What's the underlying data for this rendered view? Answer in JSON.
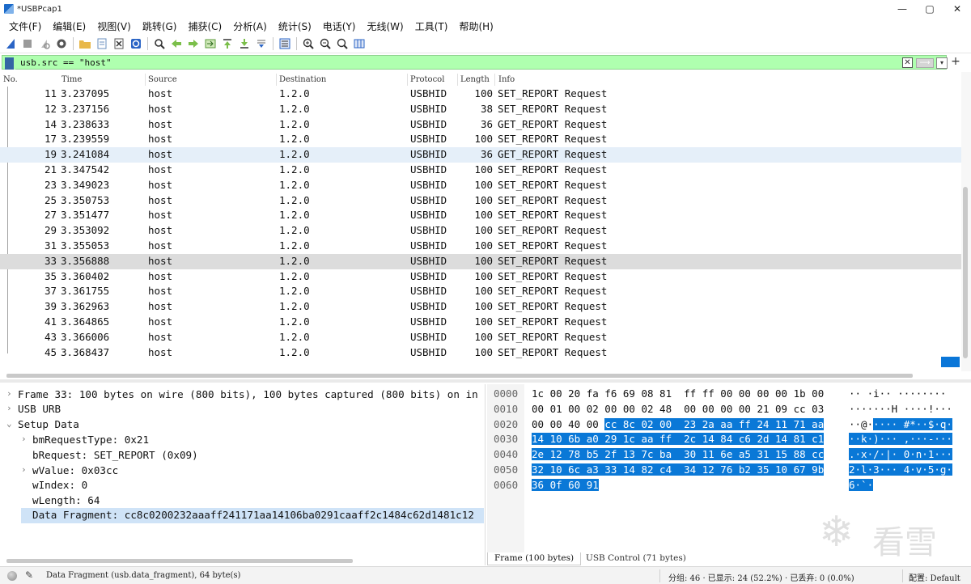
{
  "window": {
    "title": "*USBPcap1",
    "controls": [
      "—",
      "▢",
      "✕"
    ]
  },
  "menu": [
    "文件(F)",
    "编辑(E)",
    "视图(V)",
    "跳转(G)",
    "捕获(C)",
    "分析(A)",
    "统计(S)",
    "电话(Y)",
    "无线(W)",
    "工具(T)",
    "帮助(H)"
  ],
  "toolbar": {
    "icons": [
      "shark-fin-start-icon",
      "stop-icon",
      "restart-icon",
      "capture-options-icon",
      "open-folder-icon",
      "save-file-icon",
      "close-file-icon",
      "reload-icon",
      "find-packet-icon",
      "go-back-icon",
      "go-forward-icon",
      "go-to-packet-icon",
      "first-packet-icon",
      "last-packet-icon",
      "autoscroll-icon",
      "colorize-icon",
      "zoom-in-icon",
      "zoom-out-icon",
      "zoom-normal-icon",
      "resize-columns-icon"
    ]
  },
  "filter": {
    "value": "usb.src == \"host\"",
    "clear_symbol": "✕",
    "apply_symbol": "⟶",
    "dropdown_symbol": "▾",
    "add_symbol": "+"
  },
  "packet_list": {
    "columns": [
      "No.",
      "Time",
      "Source",
      "Destination",
      "Protocol",
      "Length",
      "Info"
    ],
    "rows": [
      {
        "no": "11",
        "time": "3.237095",
        "source": "host",
        "destination": "1.2.0",
        "protocol": "USBHID",
        "length": "100",
        "info": "SET_REPORT Request"
      },
      {
        "no": "12",
        "time": "3.237156",
        "source": "host",
        "destination": "1.2.0",
        "protocol": "USBHID",
        "length": "38",
        "info": "SET_REPORT Request"
      },
      {
        "no": "14",
        "time": "3.238633",
        "source": "host",
        "destination": "1.2.0",
        "protocol": "USBHID",
        "length": "36",
        "info": "GET_REPORT Request"
      },
      {
        "no": "17",
        "time": "3.239559",
        "source": "host",
        "destination": "1.2.0",
        "protocol": "USBHID",
        "length": "100",
        "info": "SET_REPORT Request"
      },
      {
        "no": "19",
        "time": "3.241084",
        "source": "host",
        "destination": "1.2.0",
        "protocol": "USBHID",
        "length": "36",
        "info": "GET_REPORT Request"
      },
      {
        "no": "21",
        "time": "3.347542",
        "source": "host",
        "destination": "1.2.0",
        "protocol": "USBHID",
        "length": "100",
        "info": "SET_REPORT Request"
      },
      {
        "no": "23",
        "time": "3.349023",
        "source": "host",
        "destination": "1.2.0",
        "protocol": "USBHID",
        "length": "100",
        "info": "SET_REPORT Request"
      },
      {
        "no": "25",
        "time": "3.350753",
        "source": "host",
        "destination": "1.2.0",
        "protocol": "USBHID",
        "length": "100",
        "info": "SET_REPORT Request"
      },
      {
        "no": "27",
        "time": "3.351477",
        "source": "host",
        "destination": "1.2.0",
        "protocol": "USBHID",
        "length": "100",
        "info": "SET_REPORT Request"
      },
      {
        "no": "29",
        "time": "3.353092",
        "source": "host",
        "destination": "1.2.0",
        "protocol": "USBHID",
        "length": "100",
        "info": "SET_REPORT Request"
      },
      {
        "no": "31",
        "time": "3.355053",
        "source": "host",
        "destination": "1.2.0",
        "protocol": "USBHID",
        "length": "100",
        "info": "SET_REPORT Request"
      },
      {
        "no": "33",
        "time": "3.356888",
        "source": "host",
        "destination": "1.2.0",
        "protocol": "USBHID",
        "length": "100",
        "info": "SET_REPORT Request"
      },
      {
        "no": "35",
        "time": "3.360402",
        "source": "host",
        "destination": "1.2.0",
        "protocol": "USBHID",
        "length": "100",
        "info": "SET_REPORT Request"
      },
      {
        "no": "37",
        "time": "3.361755",
        "source": "host",
        "destination": "1.2.0",
        "protocol": "USBHID",
        "length": "100",
        "info": "SET_REPORT Request"
      },
      {
        "no": "39",
        "time": "3.362963",
        "source": "host",
        "destination": "1.2.0",
        "protocol": "USBHID",
        "length": "100",
        "info": "SET_REPORT Request"
      },
      {
        "no": "41",
        "time": "3.364865",
        "source": "host",
        "destination": "1.2.0",
        "protocol": "USBHID",
        "length": "100",
        "info": "SET_REPORT Request"
      },
      {
        "no": "43",
        "time": "3.366006",
        "source": "host",
        "destination": "1.2.0",
        "protocol": "USBHID",
        "length": "100",
        "info": "SET_REPORT Request"
      },
      {
        "no": "45",
        "time": "3.368437",
        "source": "host",
        "destination": "1.2.0",
        "protocol": "USBHID",
        "length": "100",
        "info": "SET_REPORT Request"
      }
    ],
    "selected_no": "33",
    "hover_no": "19"
  },
  "details": [
    {
      "caret": "›",
      "text": "Frame 33: 100 bytes on wire (800 bits), 100 bytes captured (800 bits) on in"
    },
    {
      "caret": "›",
      "text": "USB URB"
    },
    {
      "caret": "⌄",
      "text": "Setup Data"
    },
    {
      "caret": "›",
      "text": "bmRequestType: 0x21"
    },
    {
      "caret": "",
      "text": "bRequest: SET_REPORT (0x09)"
    },
    {
      "caret": "›",
      "text": "wValue: 0x03cc"
    },
    {
      "caret": "",
      "text": "wIndex: 0"
    },
    {
      "caret": "",
      "text": "wLength: 64"
    },
    {
      "caret": "",
      "text": "Data Fragment: cc8c0200232aaaff241171aa14106ba0291caaff2c1484c62d1481c12"
    }
  ],
  "hex": {
    "offsets": [
      "0000",
      "0010",
      "0020",
      "0030",
      "0040",
      "0050",
      "0060"
    ],
    "rows": [
      {
        "plain": "1c 00 20 fa f6 69 08 81  ff ff 00 00 00 00 1b 00",
        "hl": "",
        "ascii_plain": "·· ·i·· ········",
        "ascii_hl": ""
      },
      {
        "plain": "00 01 00 02 00 00 02 48  00 00 00 00 21 09 cc 03",
        "hl": "",
        "ascii_plain": "·······H ····!···",
        "ascii_hl": ""
      },
      {
        "plain": "00 00 40 00 ",
        "hl": "cc 8c 02 00  23 2a aa ff 24 11 71 aa",
        "ascii_plain": "··@·",
        "ascii_hl": "···· #*··$·q·"
      },
      {
        "plain": "",
        "hl": "14 10 6b a0 29 1c aa ff  2c 14 84 c6 2d 14 81 c1",
        "ascii_plain": "",
        "ascii_hl": "··k·)··· ,···-···"
      },
      {
        "plain": "",
        "hl": "2e 12 78 b5 2f 13 7c ba  30 11 6e a5 31 15 88 cc",
        "ascii_plain": "",
        "ascii_hl": ".·x·/·|· 0·n·1···"
      },
      {
        "plain": "",
        "hl": "32 10 6c a3 33 14 82 c4  34 12 76 b2 35 10 67 9b",
        "ascii_plain": "",
        "ascii_hl": "2·l·3··· 4·v·5·g·"
      },
      {
        "plain": "",
        "hl": "36 0f 60 91",
        "ascii_plain": "",
        "ascii_hl": "6·`·"
      }
    ],
    "tabs": [
      "Frame (100 bytes)",
      "USB Control (71 bytes)"
    ]
  },
  "watermark": {
    "text": "看雪"
  },
  "status": {
    "field": "Data Fragment (usb.data_fragment), 64 byte(s)",
    "stats": "分组: 46 · 已显示: 24 (52.2%) · 已丢弃: 0 (0.0%)",
    "profile": "配置: Default"
  },
  "colors": {
    "filter_bg": "#afffaf",
    "selected_row": "#dcdcdc",
    "hover_row": "#e5eff9",
    "hex_highlight": "#0a78d7"
  }
}
